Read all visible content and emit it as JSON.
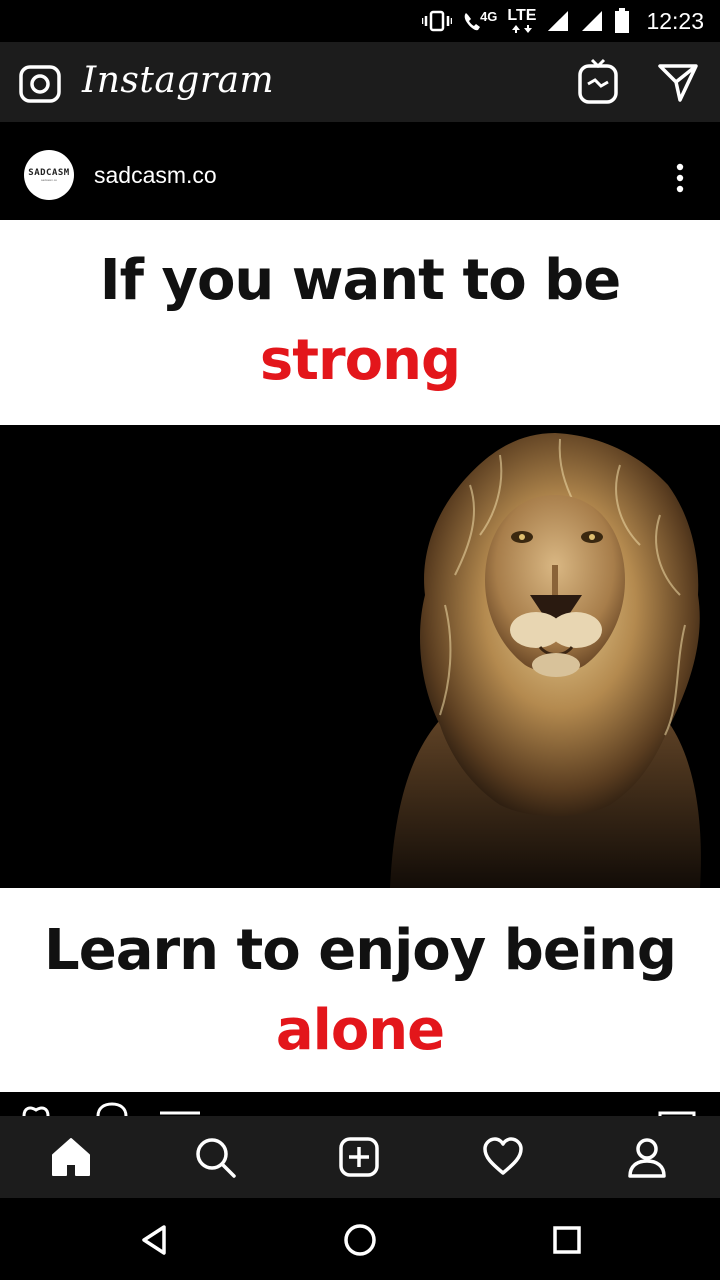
{
  "status_bar": {
    "network_label": "4G",
    "lte_label": "LTE",
    "time": "12:23",
    "icons": [
      "vibrate-icon",
      "wifi-calling-icon",
      "signal-icon",
      "signal-icon",
      "battery-icon"
    ]
  },
  "app_bar": {
    "logo": "Instagram",
    "icons": [
      "camera-icon",
      "igtv-icon",
      "direct-message-icon"
    ]
  },
  "post": {
    "username": "sadcasm.co",
    "avatar_text": "SADCASM",
    "avatar_subtext": "sadcasm.co",
    "image": {
      "top_line1": "If you want to be",
      "top_line2": "strong",
      "bottom_line1": "Learn to enjoy being",
      "bottom_line2": "alone",
      "subject_icon": "lion-illustration"
    }
  },
  "bottom_nav": {
    "items": [
      "home-icon",
      "search-icon",
      "new-post-icon",
      "activity-icon",
      "profile-icon"
    ]
  },
  "system_nav": {
    "items": [
      "back-icon",
      "home-circle-icon",
      "recents-icon"
    ]
  },
  "colors": {
    "bar_bg": "#1c1c1c",
    "accent_red": "#e3161b",
    "text_dark": "#111111"
  }
}
